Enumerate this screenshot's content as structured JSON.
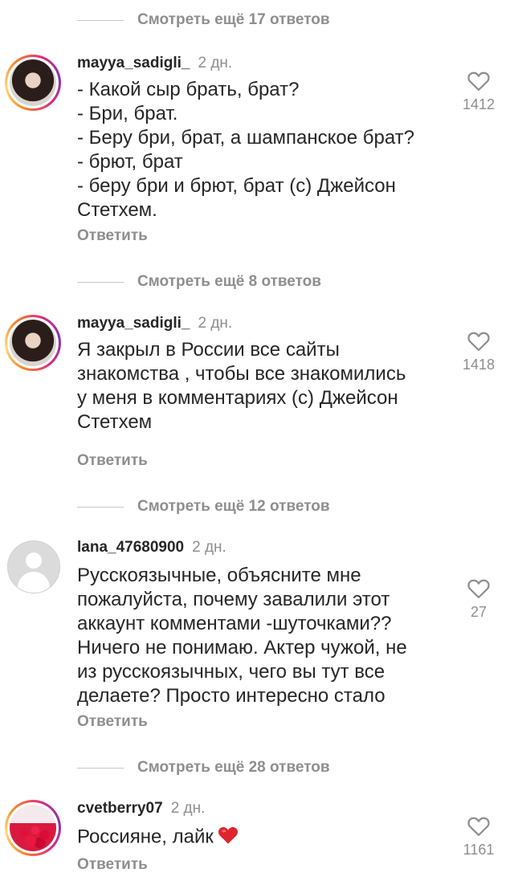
{
  "threads": [
    {
      "more_replies": "Смотреть ещё 17 ответов"
    },
    {
      "more_replies": "Смотреть ещё 8 ответов"
    },
    {
      "more_replies": "Смотреть ещё 12 ответов"
    },
    {
      "more_replies": "Смотреть ещё 28 ответов"
    }
  ],
  "comments": [
    {
      "username": "mayya_sadigli_",
      "time": "2 дн.",
      "lines": [
        "- Какой сыр брать, брат?",
        "- Бри, брат.",
        "- Беру бри, брат, а шампанское брат?",
        "- брют, брат",
        "- беру бри и брют, брат (с) Джейсон",
        "Стетхем."
      ],
      "likes": "1412",
      "reply": "Ответить",
      "avatar_icon": "profile-photo-woman"
    },
    {
      "username": "mayya_sadigli_",
      "time": "2 дн.",
      "lines": [
        "Я закрыл в России все сайты",
        "знакомства , чтобы все знакомились",
        "у меня в комментариях (с) Джейсон",
        "Стетхем"
      ],
      "likes": "1418",
      "reply": "Ответить",
      "avatar_icon": "profile-photo-woman"
    },
    {
      "username": "lana_47680900",
      "time": "2 дн.",
      "lines": [
        "Русскоязычные, объясните мне",
        "пожалуйста, почему завалили этот",
        "аккаунт комментами -шуточками??",
        "Ничего не понимаю. Актер чужой, не",
        "из русскоязычных, чего вы тут все",
        "делаете? Просто интересно стало"
      ],
      "likes": "27",
      "reply": "Ответить",
      "avatar_icon": "default-avatar-icon"
    },
    {
      "username": "cvetberry07",
      "time": "2 дн.",
      "lines": [
        "Россияне, лайк"
      ],
      "likes": "1161",
      "reply": "Ответить",
      "avatar_icon": "profile-photo-roses"
    }
  ],
  "colors": {
    "text": "#262626",
    "muted": "#8e8e8e",
    "heart_emoji": "#e0242b"
  }
}
